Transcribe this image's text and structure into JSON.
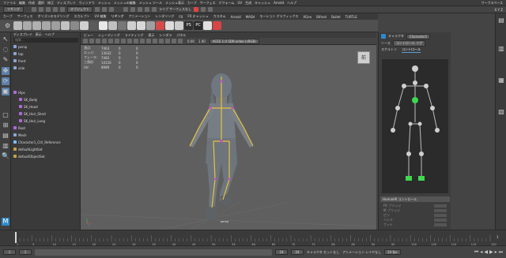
{
  "menubar": {
    "items": [
      "ファイル",
      "編集",
      "作成",
      "選択",
      "修正",
      "ディスプレイ",
      "ウィンドウ",
      "メッシュ",
      "メッシュの編集",
      "メッシュ ツール",
      "メッシュ表示",
      "カーブ",
      "サーフェス",
      "デフォーム",
      "UV",
      "生成",
      "キャッシュ",
      "Arnold",
      "ヘルプ"
    ],
    "workspace_label": "ワークスペース"
  },
  "statusline": {
    "mode": "リギング",
    "obj_label": "オブジェクト",
    "live_label": "ライブ サーフェスなし",
    "coords": "X Y Z"
  },
  "shelf_tabs": [
    "カーブ",
    "サーフェス",
    "ポリゴンのモデリング",
    "スカルプト",
    "UV 編集",
    "リギング",
    "アニメーション",
    "レンダリング",
    "FX",
    "FX キャッシュ",
    "カスタム",
    "Arnold",
    "MASH",
    "モーション グラフィックス",
    "XGen",
    "Bifrost",
    "Bullet",
    "TURTLE"
  ],
  "shelf_icons": [
    {
      "name": "sphere",
      "color": "#bbbbbb"
    },
    {
      "name": "cube",
      "color": "#aaaaaa"
    },
    {
      "name": "cylinder",
      "color": "#b0b0b0"
    },
    {
      "name": "cone",
      "color": "#a8a8a8"
    },
    {
      "name": "plane",
      "color": "#9f9f9f"
    },
    {
      "name": "torus",
      "color": "#c2c2c2"
    },
    {
      "name": "disc",
      "color": "#8a8a8a"
    },
    {
      "name": "material",
      "color": "#d0d0d0"
    },
    {
      "name": "shader",
      "color": "#5a5a5a"
    },
    {
      "name": "light",
      "color": "#e8e8e8"
    },
    {
      "name": "camera",
      "color": "#c0c0c0"
    },
    {
      "name": "group",
      "color": "#777777"
    },
    {
      "name": "joint",
      "color": "#cfcfcf"
    },
    {
      "name": "skin",
      "color": "#d8d8d8"
    },
    {
      "name": "cluster",
      "color": "#a0a0a0"
    },
    {
      "name": "color",
      "color": "#d64a4a"
    },
    {
      "name": "hair",
      "color": "#dddddd"
    },
    {
      "name": "ncloth",
      "color": "#cccccc"
    },
    {
      "name": "ps",
      "color": "#2f2f2f"
    },
    {
      "name": "pc",
      "color": "#2a2a2a"
    },
    {
      "name": "render",
      "color": "#e0e0e0"
    },
    {
      "name": "ipr",
      "color": "#d54545"
    }
  ],
  "shelf_badges": {
    "ps": "PS",
    "pc": "PC"
  },
  "outliner": {
    "menu": [
      "ディスプレイ",
      "表示",
      "ヘルプ"
    ],
    "search_placeholder": "検索...",
    "items": [
      {
        "label": "persp",
        "indent": 0,
        "color": "#8aa7d6"
      },
      {
        "label": "top",
        "indent": 0,
        "color": "#8aa7d6"
      },
      {
        "label": "front",
        "indent": 0,
        "color": "#8aa7d6"
      },
      {
        "label": "side",
        "indent": 0,
        "color": "#8aa7d6"
      },
      {
        "label": "Hips",
        "indent": 0,
        "color": "#b06ad8"
      },
      {
        "label": "SK_Body",
        "indent": 1,
        "color": "#b06ad8"
      },
      {
        "label": "SK_Head",
        "indent": 1,
        "color": "#b06ad8"
      },
      {
        "label": "SK_Hair_Short",
        "indent": 1,
        "color": "#b06ad8"
      },
      {
        "label": "SK_Hair_Long",
        "indent": 1,
        "color": "#b06ad8"
      },
      {
        "label": "Root",
        "indent": 0,
        "color": "#b06ad8"
      },
      {
        "label": "Mesh",
        "indent": 0,
        "color": "#8aa7d6"
      },
      {
        "label": "Character1_Ctrl_Reference",
        "indent": 0,
        "color": "#7fc0ff"
      },
      {
        "label": "defaultLightSet",
        "indent": 0,
        "color": "#c9a24a"
      },
      {
        "label": "defaultObjectSet",
        "indent": 0,
        "color": "#c9a24a"
      }
    ]
  },
  "viewport": {
    "menu": [
      "ビュー",
      "シェーディング",
      "ライティング",
      "表示",
      "レンダラ",
      "パネル"
    ],
    "exposure": "0.00",
    "gamma": "1.00",
    "colorspace": "ACES 1.0 SDR-video (sRGB)",
    "hud": [
      {
        "label": "頂点:",
        "v1": "7463",
        "v2": "0",
        "v3": "0"
      },
      {
        "label": "エッジ:",
        "v1": "13632",
        "v2": "0",
        "v3": "0"
      },
      {
        "label": "フェース:",
        "v1": "7483",
        "v2": "0",
        "v3": "0"
      },
      {
        "label": "三角形:",
        "v1": "14116",
        "v2": "0",
        "v3": "0"
      },
      {
        "label": "UV:",
        "v1": "8989",
        "v2": "0",
        "v3": "0"
      }
    ],
    "viewcube_label": "前",
    "camera_label": "persp"
  },
  "hik": {
    "character_label": "キャラクタ",
    "character": "Character1",
    "source_label": "ソース",
    "source": "コントロール リグ",
    "tabs": [
      "スケルトン",
      "コントロール"
    ],
    "section_title": "HumanIK コントロール",
    "options": [
      "FK ブリッジ",
      "IK ブリッジ",
      "ピン",
      "ハンド",
      "フット"
    ]
  },
  "timeline": {
    "ticks": [
      "1",
      "5",
      "10",
      "15",
      "20",
      "25",
      "30",
      "35",
      "40",
      "45",
      "50",
      "55",
      "60",
      "65",
      "70",
      "75",
      "80",
      "85",
      "90",
      "95",
      "100",
      "105",
      "110",
      "115",
      "120"
    ],
    "current_frame": "1"
  },
  "rangebar": {
    "start": "1",
    "range_start": "1",
    "range_end": "24",
    "end": "24",
    "char_set": "キャラクタ セットなし",
    "anim_layer": "アニメーション レイヤなし",
    "fps": "24 fps"
  }
}
